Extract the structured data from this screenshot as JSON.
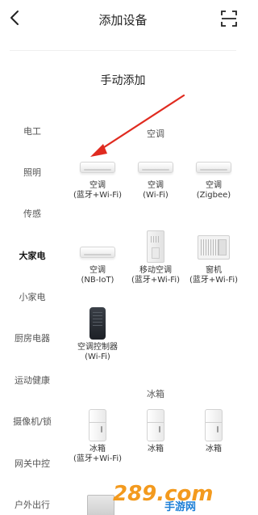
{
  "header": {
    "title": "添加设备"
  },
  "subtitle": "手动添加",
  "sidebar": {
    "items": [
      {
        "label": "电工"
      },
      {
        "label": "照明"
      },
      {
        "label": "传感"
      },
      {
        "label": "大家电",
        "active": true
      },
      {
        "label": "小家电"
      },
      {
        "label": "厨房电器"
      },
      {
        "label": "运动健康"
      },
      {
        "label": "摄像机/锁"
      },
      {
        "label": "网关中控"
      },
      {
        "label": "户外出行"
      }
    ]
  },
  "sections": {
    "ac": {
      "title": "空调",
      "items": [
        {
          "line1": "空调",
          "line2": "(蓝牙+Wi-Fi)"
        },
        {
          "line1": "空调",
          "line2": "(Wi-Fi)"
        },
        {
          "line1": "空调",
          "line2": "(Zigbee)"
        },
        {
          "line1": "空调",
          "line2": "(NB-IoT)"
        },
        {
          "line1": "移动空调",
          "line2": "(蓝牙+Wi-Fi)"
        },
        {
          "line1": "窗机",
          "line2": "(蓝牙+Wi-Fi)"
        },
        {
          "line1": "空调控制器",
          "line2": "(Wi-Fi)"
        }
      ]
    },
    "fridge": {
      "title": "冰箱",
      "items": [
        {
          "line1": "冰箱",
          "line2": "(蓝牙+Wi-Fi)"
        },
        {
          "line1": "冰箱",
          "line2": ""
        },
        {
          "line1": "冰箱",
          "line2": ""
        }
      ]
    }
  },
  "watermark": {
    "text": "289.com",
    "sub": "手游网"
  },
  "colors": {
    "arrow": "#e02b20",
    "watermark_orange": "#f39a1e",
    "watermark_blue": "#1d7fd6"
  },
  "icons": {
    "back": "chevron-left-icon",
    "scan": "scan-icon"
  }
}
